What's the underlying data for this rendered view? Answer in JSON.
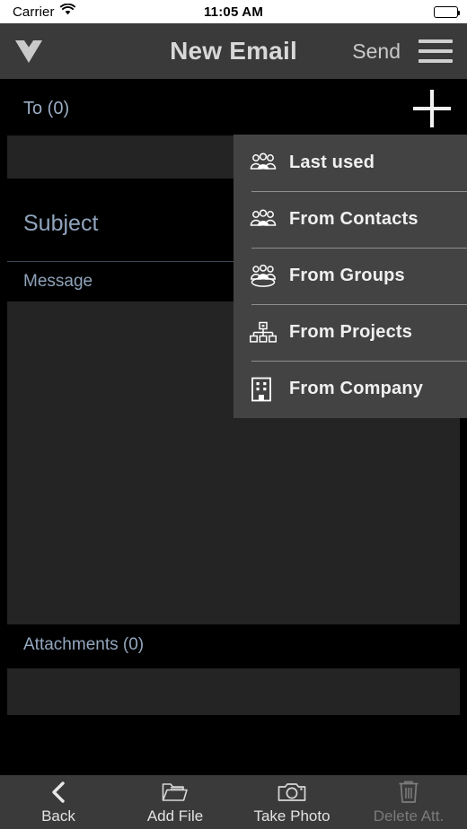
{
  "statusbar": {
    "carrier": "Carrier",
    "wifi_icon": "wifi-icon",
    "time": "11:05 AM",
    "battery_icon": "battery-full-icon"
  },
  "navbar": {
    "logo_icon": "v-logo-icon",
    "title": "New Email",
    "send_label": "Send",
    "menu_icon": "hamburger-menu-icon"
  },
  "compose": {
    "to_label": "To (0)",
    "add_recipient_icon": "plus-icon",
    "to_value": "",
    "subject_placeholder": "Subject",
    "subject_value": "",
    "message_placeholder": "Message",
    "message_value": "",
    "attachments_label": "Attachments (0)"
  },
  "recipient_menu": {
    "items": [
      {
        "label": "Last used",
        "icon": "people-group-icon"
      },
      {
        "label": "From Contacts",
        "icon": "people-group-icon"
      },
      {
        "label": "From Groups",
        "icon": "people-group-circle-icon"
      },
      {
        "label": "From Projects",
        "icon": "org-chart-icon"
      },
      {
        "label": "From Company",
        "icon": "building-icon"
      }
    ]
  },
  "toolbar": {
    "items": [
      {
        "label": "Back",
        "icon": "chevron-left-icon",
        "disabled": false
      },
      {
        "label": "Add File",
        "icon": "folder-icon",
        "disabled": false
      },
      {
        "label": "Take Photo",
        "icon": "camera-icon",
        "disabled": false
      },
      {
        "label": "Delete Att.",
        "icon": "trash-icon",
        "disabled": true
      }
    ]
  },
  "colors": {
    "background": "#000000",
    "bar": "#3a3a3a",
    "field": "#242424",
    "menu": "#434343",
    "accent_text": "#93a7be",
    "disabled_text": "#7a7a7a"
  }
}
